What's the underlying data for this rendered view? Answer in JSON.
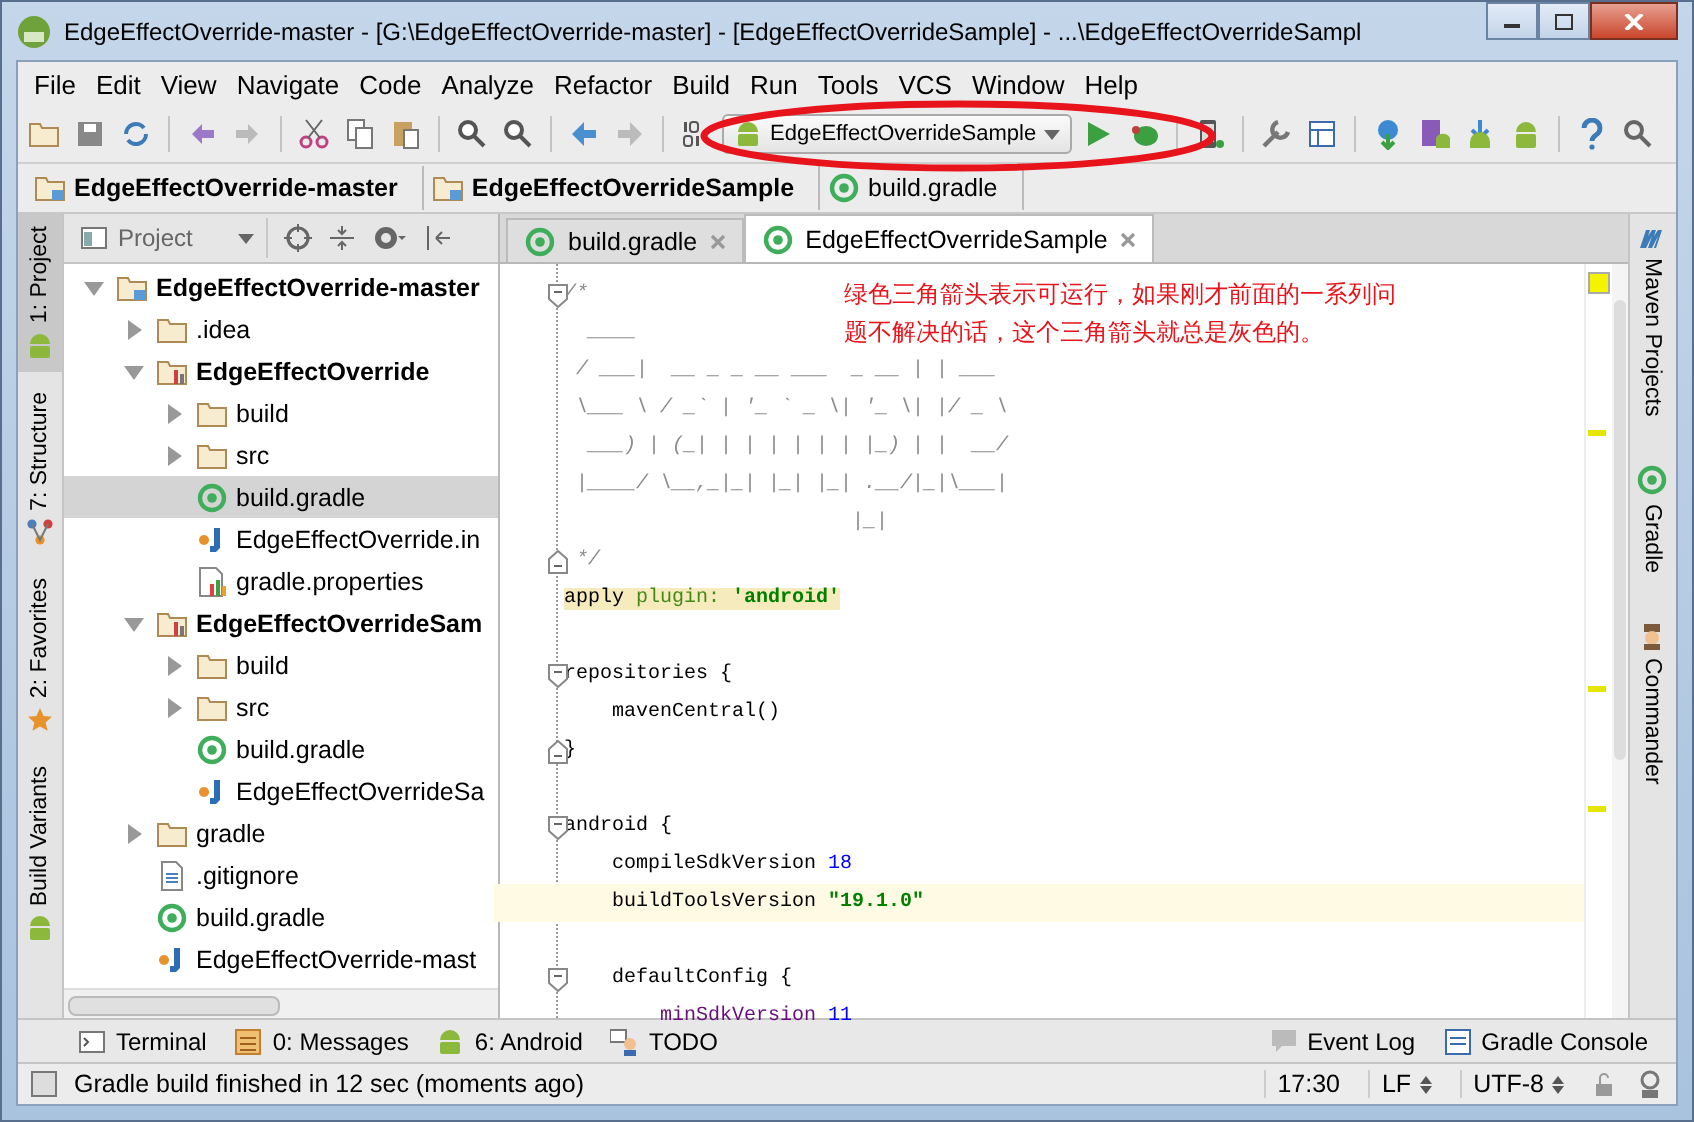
{
  "window": {
    "title": "EdgeEffectOverride-master - [G:\\EdgeEffectOverride-master] - [EdgeEffectOverrideSample] - ...\\EdgeEffectOverrideSampl"
  },
  "menu": [
    {
      "label": "File"
    },
    {
      "label": "Edit"
    },
    {
      "label": "View"
    },
    {
      "label": "Navigate"
    },
    {
      "label": "Code"
    },
    {
      "label": "Analyze"
    },
    {
      "label": "Refactor"
    },
    {
      "label": "Build"
    },
    {
      "label": "Run"
    },
    {
      "label": "Tools"
    },
    {
      "label": "VCS"
    },
    {
      "label": "Window"
    },
    {
      "label": "Help"
    }
  ],
  "toolbar": {
    "run_config": "EdgeEffectOverrideSample"
  },
  "breadcrumbs": [
    {
      "label": "EdgeEffectOverride-master",
      "kind": "project"
    },
    {
      "label": "EdgeEffectOverrideSample",
      "kind": "project"
    },
    {
      "label": "build.gradle",
      "kind": "gradle"
    }
  ],
  "left_tool_tabs": [
    {
      "label": "1: Project",
      "selected": true,
      "kind": "android"
    },
    {
      "label": "7: Structure",
      "selected": false,
      "kind": "structure"
    },
    {
      "label": "2: Favorites",
      "selected": false,
      "kind": "star"
    },
    {
      "label": "Build Variants",
      "selected": false,
      "kind": "android"
    }
  ],
  "project_panel": {
    "view": "Project",
    "tree": [
      {
        "label": "EdgeEffectOverride-master",
        "kind": "root",
        "expanded": true,
        "selected": false,
        "children": [
          {
            "label": ".idea",
            "kind": "folder",
            "expanded": false,
            "selected": false
          },
          {
            "label": "EdgeEffectOverride",
            "kind": "module",
            "expanded": true,
            "selected": false,
            "children": [
              {
                "label": "build",
                "kind": "folder",
                "expanded": false,
                "selected": false
              },
              {
                "label": "src",
                "kind": "folder",
                "expanded": false,
                "selected": false
              },
              {
                "label": "build.gradle",
                "kind": "gradle",
                "selected": true
              },
              {
                "label": "EdgeEffectOverride.in",
                "kind": "iml",
                "selected": false
              },
              {
                "label": "gradle.properties",
                "kind": "properties",
                "selected": false
              }
            ]
          },
          {
            "label": "EdgeEffectOverrideSam",
            "kind": "module",
            "expanded": true,
            "selected": false,
            "children": [
              {
                "label": "build",
                "kind": "folder",
                "expanded": false,
                "selected": false
              },
              {
                "label": "src",
                "kind": "folder",
                "expanded": false,
                "selected": false
              },
              {
                "label": "build.gradle",
                "kind": "gradle",
                "selected": false
              },
              {
                "label": "EdgeEffectOverrideSa",
                "kind": "iml",
                "selected": false
              }
            ]
          },
          {
            "label": "gradle",
            "kind": "folder",
            "expanded": false,
            "selected": false
          },
          {
            "label": ".gitignore",
            "kind": "text",
            "selected": false
          },
          {
            "label": "build.gradle",
            "kind": "gradle",
            "selected": false
          },
          {
            "label": "EdgeEffectOverride-mast",
            "kind": "iml",
            "selected": false
          }
        ]
      }
    ]
  },
  "editor": {
    "tabs": [
      {
        "label": "build.gradle",
        "selected": false
      },
      {
        "label": "EdgeEffectOverrideSample",
        "selected": true
      }
    ],
    "lines": [
      {
        "fold_open": true,
        "segments": [
          {
            "kind": "comment",
            "text": "/*"
          }
        ]
      },
      {
        "segments": [
          {
            "kind": "comment",
            "text": "  ____"
          }
        ]
      },
      {
        "segments": [
          {
            "kind": "comment",
            "text": " / ___|  __ _ _ __ ___  _ __ | | ___"
          }
        ]
      },
      {
        "segments": [
          {
            "kind": "comment",
            "text": " \\___ \\ / _` | '_ ` _ \\| '_ \\| |/ _ \\"
          }
        ]
      },
      {
        "segments": [
          {
            "kind": "comment",
            "text": "  ___) | (_| | | | | | | |_) | |  __/"
          }
        ]
      },
      {
        "segments": [
          {
            "kind": "comment",
            "text": " |____/ \\__,_|_| |_| |_| .__/|_|\\___|"
          }
        ]
      },
      {
        "segments": [
          {
            "kind": "comment",
            "text": "                        |_|"
          }
        ]
      },
      {
        "fold_close": true,
        "segments": [
          {
            "kind": "comment",
            "text": " */"
          }
        ]
      },
      {
        "marked": true,
        "segments": [
          {
            "kind": "plain",
            "text": "apply "
          },
          {
            "kind": "label",
            "text": "plugin: "
          },
          {
            "kind": "string",
            "text": "'android'"
          }
        ]
      },
      {
        "space_before": true,
        "fold_open": true,
        "segments": [
          {
            "kind": "plain",
            "text": "repositories {"
          }
        ]
      },
      {
        "segments": [
          {
            "kind": "plain",
            "text": "    mavenCentral()"
          }
        ]
      },
      {
        "fold_close": true,
        "segments": [
          {
            "kind": "plain",
            "text": "}"
          }
        ]
      },
      {
        "space_before": true,
        "fold_open": true,
        "segments": [
          {
            "kind": "plain",
            "text": "android {"
          }
        ]
      },
      {
        "segments": [
          {
            "kind": "plain",
            "text": "    compileSdkVersion "
          },
          {
            "kind": "number",
            "text": "18"
          }
        ]
      },
      {
        "current": true,
        "segments": [
          {
            "kind": "plain",
            "text": "    buildToolsVersion "
          },
          {
            "kind": "string",
            "text": "\"19.1.0\""
          }
        ]
      },
      {
        "space_before": true,
        "fold_open": true,
        "segments": [
          {
            "kind": "plain",
            "text": "    defaultConfig {"
          }
        ]
      },
      {
        "segments": [
          {
            "kind": "field",
            "text": "        minSdkVersion "
          },
          {
            "kind": "number",
            "text": "11"
          }
        ]
      }
    ],
    "note": [
      "绿色三角箭头表示可运行，如果刚才前面的一系列问",
      "题不解决的话，这个三角箭头就总是灰色的。"
    ]
  },
  "right_tool_tabs": [
    {
      "label": "Maven Projects",
      "kind": "maven"
    },
    {
      "label": "Gradle",
      "kind": "gradle"
    },
    {
      "label": "Commander",
      "kind": "commander"
    }
  ],
  "bottom_tool_tabs_left": [
    {
      "label": "Terminal",
      "kind": "terminal"
    },
    {
      "label": "0: Messages",
      "kind": "messages"
    },
    {
      "label": "6: Android",
      "kind": "android"
    },
    {
      "label": "TODO",
      "kind": "todo"
    }
  ],
  "bottom_tool_tabs_right": [
    {
      "label": "Event Log",
      "kind": "eventlog"
    },
    {
      "label": "Gradle Console",
      "kind": "console"
    }
  ],
  "status_bar": {
    "message": "Gradle build finished in 12 sec (moments ago)",
    "position": "17:30",
    "line_separator": "LF",
    "encoding": "UTF-8"
  }
}
